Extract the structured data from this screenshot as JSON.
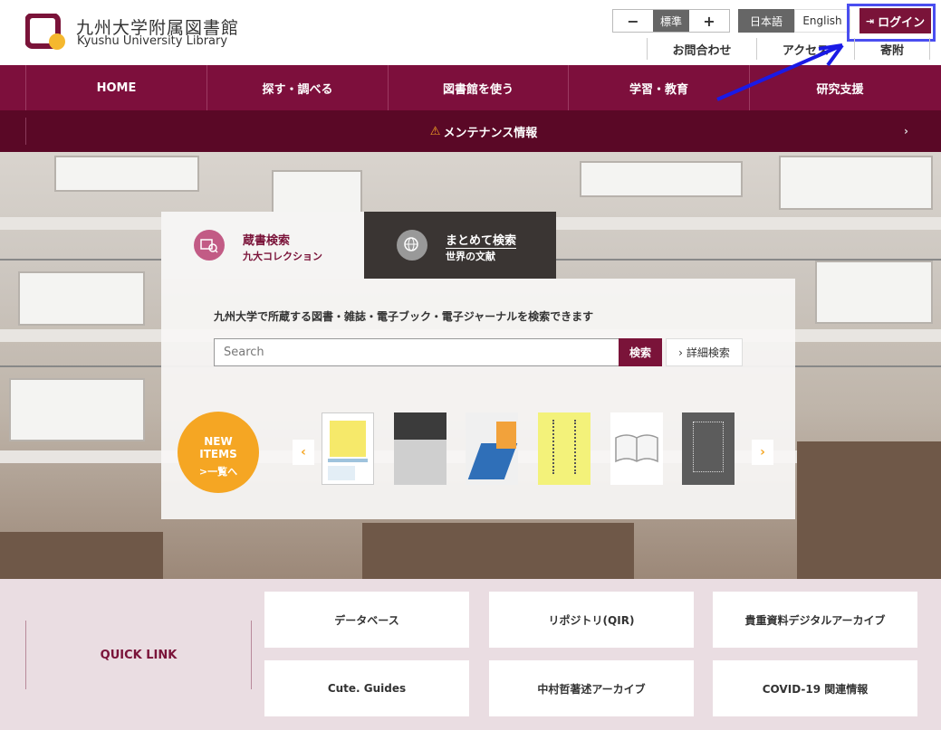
{
  "header": {
    "logo_ja": "九州大学附属図書館",
    "logo_en": "Kyushu University Library",
    "font_size": {
      "minus": "−",
      "standard": "標準",
      "plus": "+"
    },
    "lang": {
      "ja": "日本語",
      "en": "English"
    },
    "login_label": "ログイン",
    "sublinks": [
      "お問合わせ",
      "アクセス",
      "寄附"
    ]
  },
  "nav": {
    "items": [
      "HOME",
      "探す・調べる",
      "図書館を使う",
      "学習・教育",
      "研究支援"
    ]
  },
  "maintenance": {
    "label": "メンテナンス情報",
    "arrow": "›"
  },
  "search": {
    "tabs": [
      {
        "title": "蔵書検索",
        "subtitle": "九大コレクション"
      },
      {
        "title": "まとめて検索",
        "subtitle": "世界の文献"
      }
    ],
    "description": "九州大学で所蔵する図書・雑誌・電子ブック・電子ジャーナルを検索できます",
    "placeholder": "Search",
    "button": "検索",
    "advanced": "詳細検索"
  },
  "new_items": {
    "line1": "NEW",
    "line2": "ITEMS",
    "link": ">一覧へ",
    "prev": "‹",
    "next": "›"
  },
  "quick_link": {
    "label": "QUICK LINK",
    "items": [
      "データベース",
      "リポジトリ(QIR)",
      "貴重資料デジタルアーカイブ",
      "Cute. Guides",
      "中村哲著述アーカイブ",
      "COVID-19 関連情報"
    ]
  },
  "colors": {
    "brand": "#7a1339",
    "nav": "#7d0f3c",
    "accent": "#f5a623",
    "annotation": "#4a4ef0"
  }
}
